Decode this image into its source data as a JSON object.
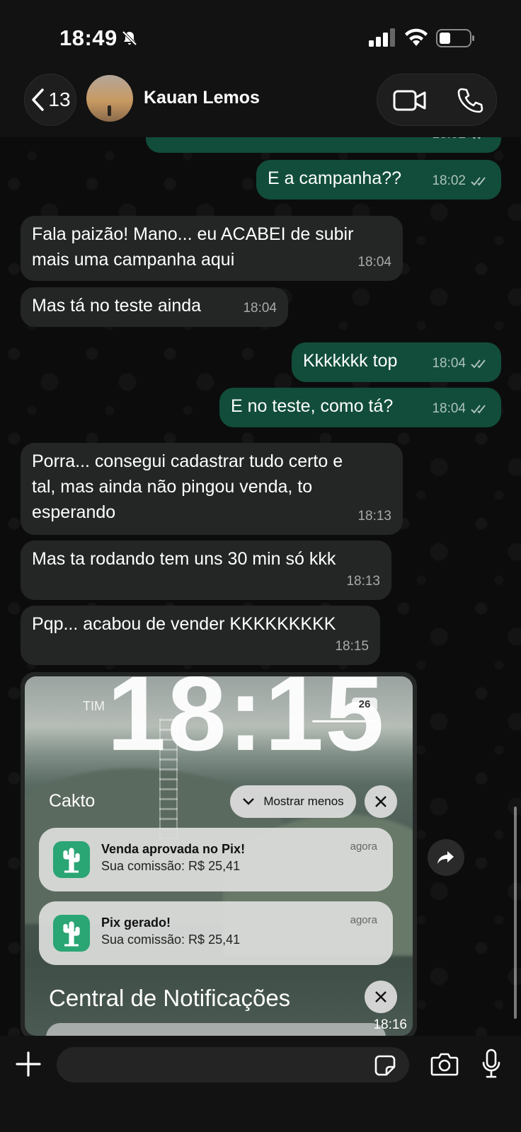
{
  "status_bar": {
    "time": "18:49"
  },
  "header": {
    "back_count": "13",
    "contact_name": "Kauan Lemos"
  },
  "messages": [
    {
      "dir": "out",
      "text": "",
      "time": "18:02"
    },
    {
      "dir": "out",
      "text": "E a campanha??",
      "time": "18:02"
    },
    {
      "dir": "in",
      "text": "Fala paizão! Mano... eu ACABEI de subir\nmais uma campanha aqui",
      "time": "18:04"
    },
    {
      "dir": "in",
      "text": "Mas tá no teste ainda",
      "time": "18:04"
    },
    {
      "dir": "out",
      "text": "Kkkkkkk top",
      "time": "18:04"
    },
    {
      "dir": "out",
      "text": "E no teste, como tá?",
      "time": "18:04"
    },
    {
      "dir": "in",
      "text": "Porra... consegui cadastrar tudo certo e\ntal, mas ainda não pingou venda, to\nesperando",
      "time": "18:13"
    },
    {
      "dir": "in",
      "text": "Mas ta rodando tem uns 30 min só kkk",
      "time": "18:13"
    },
    {
      "dir": "in",
      "text": "Pqp... acabou de vender KKKKKKKKK",
      "time": "18:15"
    }
  ],
  "image_message": {
    "time": "18:16",
    "lock_time": "18:15",
    "carrier": "TIM",
    "battery": "26",
    "app_group": "Cakto",
    "show_less": "Mostrar menos",
    "notifications": [
      {
        "title": "Venda aprovada no Pix!",
        "body": "Sua comissão: R$ 25,41",
        "time": "agora"
      },
      {
        "title": "Pix gerado!",
        "body": "Sua comissão: R$ 25,41",
        "time": "agora"
      }
    ],
    "center_title": "Central de Notificações"
  },
  "input": {
    "placeholder": ""
  },
  "colors": {
    "incoming": "#242626",
    "outgoing": "#114d3a",
    "app_icon": "#2aa574"
  },
  "icons": [
    "bell-off-icon",
    "signal-icon",
    "wifi-icon",
    "battery-icon",
    "chevron-left-icon",
    "video-icon",
    "phone-icon",
    "double-check-icon",
    "forward-icon",
    "plus-icon",
    "sticker-icon",
    "camera-icon",
    "mic-icon",
    "cactus-icon",
    "close-icon",
    "chevron-down-icon"
  ]
}
